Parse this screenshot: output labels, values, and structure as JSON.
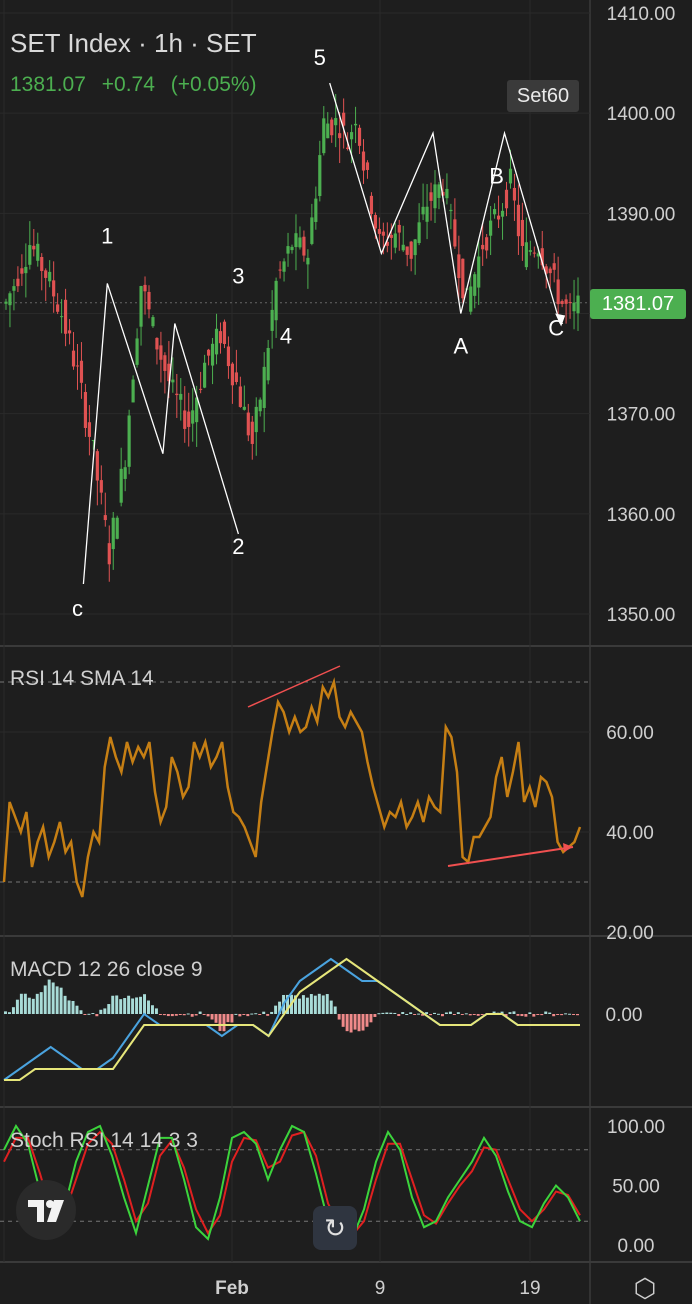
{
  "header": {
    "title": "SET Index · 1h · SET",
    "price": "1381.07",
    "change": "+0.74",
    "change_pct": "(+0.05%)"
  },
  "badges": {
    "set60": "Set60",
    "last_price": "1381.07"
  },
  "colors": {
    "background": "#1e1e1e",
    "up": "#4caf50",
    "down": "#e05252",
    "rsi": "#c67f14",
    "macd": "#4aa3df",
    "signal": "#e6e67a",
    "stoch_k": "#3cd43c",
    "stoch_d": "#e02020",
    "annotation": "#ffffff",
    "divergence": "#f05050"
  },
  "icons": {
    "logo": "tradingview-logo-icon",
    "reset": "reset-rotate-icon",
    "settings": "settings-hexagon-icon"
  },
  "chart_data": [
    {
      "type": "candlestick",
      "title": "SET Index · 1h · SET",
      "ylim": [
        1347,
        1410
      ],
      "y_ticks": [
        "1410.00",
        "1400.00",
        "1390.00",
        "1381.07",
        "1370.00",
        "1360.00",
        "1350.00"
      ],
      "x_ticks": [
        "Feb",
        "9",
        "19"
      ],
      "bars": 145,
      "close_path": [
        [
          0,
          1381
        ],
        [
          6,
          1387
        ],
        [
          10,
          1384
        ],
        [
          14,
          1380
        ],
        [
          18,
          1374
        ],
        [
          22,
          1366
        ],
        [
          26,
          1356
        ],
        [
          30,
          1366
        ],
        [
          34,
          1383
        ],
        [
          38,
          1377
        ],
        [
          42,
          1372
        ],
        [
          46,
          1369
        ],
        [
          50,
          1375
        ],
        [
          54,
          1378
        ],
        [
          58,
          1373
        ],
        [
          62,
          1367
        ],
        [
          65,
          1374
        ],
        [
          68,
          1383
        ],
        [
          72,
          1387
        ],
        [
          76,
          1386
        ],
        [
          80,
          1399
        ],
        [
          84,
          1399
        ],
        [
          86,
          1397
        ],
        [
          88,
          1400
        ],
        [
          90,
          1395
        ],
        [
          94,
          1387
        ],
        [
          98,
          1388
        ],
        [
          102,
          1386
        ],
        [
          106,
          1391
        ],
        [
          110,
          1393
        ],
        [
          112,
          1389
        ],
        [
          116,
          1381
        ],
        [
          120,
          1387
        ],
        [
          124,
          1390
        ],
        [
          127,
          1393
        ],
        [
          130,
          1386
        ],
        [
          134,
          1387
        ],
        [
          138,
          1383
        ],
        [
          140,
          1381
        ],
        [
          142,
          1380
        ],
        [
          145,
          1381
        ]
      ],
      "wave_labels": [
        {
          "label": "1",
          "x": 26,
          "y": 1382
        },
        {
          "label": "2",
          "x": 59,
          "y": 1358
        },
        {
          "label": "3",
          "x": 59,
          "y": 1380
        },
        {
          "label": "4",
          "x": 71,
          "y": 1380
        },
        {
          "label": "5",
          "x": 82,
          "y": 1402
        },
        {
          "label": "c",
          "x": 20,
          "y": 1353
        },
        {
          "label": "A",
          "x": 115,
          "y": 1380
        },
        {
          "label": "B",
          "x": 124,
          "y": 1392
        },
        {
          "label": "C",
          "x": 139,
          "y": 1380
        }
      ],
      "wave_path": [
        [
          20,
          1353
        ],
        [
          26,
          1383
        ],
        [
          40,
          1366
        ],
        [
          43,
          1379
        ],
        [
          59,
          1358
        ]
      ],
      "wave_path2": [
        [
          82,
          1403
        ],
        [
          95,
          1386
        ],
        [
          108,
          1398
        ],
        [
          115,
          1380
        ],
        [
          126,
          1398
        ],
        [
          140,
          1379
        ]
      ]
    },
    {
      "type": "line",
      "title": "RSI 14 SMA 14",
      "ylim": [
        20,
        73
      ],
      "y_ticks": [
        "60.00",
        "40.00",
        "20.00"
      ],
      "levels": [
        70,
        30
      ],
      "values": [
        30,
        46,
        43,
        40,
        44,
        33,
        38,
        41,
        35,
        38,
        42,
        36,
        38,
        30,
        27,
        35,
        40,
        38,
        53,
        59,
        55,
        52,
        58,
        54,
        57,
        55,
        58,
        48,
        42,
        45,
        55,
        52,
        47,
        49,
        58,
        55,
        58,
        53,
        55,
        58,
        49,
        44,
        43,
        41,
        38,
        35,
        46,
        53,
        60,
        66,
        64,
        60,
        63,
        60,
        61,
        65,
        62,
        69,
        67,
        70,
        63,
        61,
        64,
        62,
        60,
        54,
        49,
        45,
        41,
        44,
        43,
        46,
        41,
        43,
        46,
        42,
        47,
        45,
        44,
        61,
        59,
        52,
        35,
        34,
        39,
        39,
        41,
        43,
        51,
        55,
        47,
        52,
        58,
        46,
        49,
        45,
        51,
        50,
        47,
        38,
        36,
        37,
        38,
        41
      ]
    },
    {
      "type": "line",
      "title": "MACD 12 26 close 9",
      "ylim": [
        -7,
        6
      ],
      "y_ticks": [
        "0.00"
      ],
      "series": [
        {
          "values": [
            -6,
            -5,
            -4,
            -3,
            -4,
            -5,
            -5,
            -4,
            -2,
            0,
            -1,
            -1,
            -1,
            -1,
            -2,
            -1,
            -1,
            -2,
            1,
            3,
            4,
            5,
            4,
            3,
            3,
            2,
            1,
            0,
            -1,
            -1,
            -1,
            0,
            0,
            -1,
            -1,
            -1,
            -1,
            -1
          ]
        },
        {
          "values": [
            -6,
            -6,
            -5,
            -5,
            -5,
            -5,
            -5,
            -5,
            -3,
            -1,
            -1,
            -1,
            -1,
            -1,
            -1,
            -1,
            -1,
            -2,
            0,
            2,
            3,
            4,
            5,
            4,
            3,
            2,
            1,
            0,
            -1,
            -1,
            -1,
            0,
            0,
            -1,
            -1,
            -1,
            -1,
            -1
          ]
        }
      ]
    },
    {
      "type": "line",
      "title": "Stoch RSI 14 14 3 3",
      "ylim": [
        -5,
        110
      ],
      "y_ticks": [
        "100.00",
        "50.00",
        "0.00"
      ],
      "levels": [
        80,
        20
      ],
      "series": [
        {
          "values": [
            80,
            100,
            85,
            45,
            15,
            30,
            70,
            95,
            100,
            75,
            40,
            10,
            50,
            90,
            90,
            55,
            15,
            5,
            40,
            90,
            95,
            85,
            55,
            80,
            100,
            95,
            60,
            20,
            10,
            5,
            30,
            70,
            95,
            80,
            40,
            15,
            20,
            40,
            55,
            70,
            90,
            75,
            45,
            20,
            15,
            35,
            50,
            40,
            20
          ]
        },
        {
          "values": [
            70,
            90,
            90,
            60,
            25,
            25,
            55,
            85,
            95,
            85,
            55,
            20,
            35,
            75,
            88,
            65,
            30,
            10,
            25,
            70,
            90,
            88,
            65,
            70,
            92,
            95,
            75,
            35,
            15,
            8,
            20,
            55,
            85,
            85,
            55,
            25,
            18,
            35,
            50,
            62,
            82,
            80,
            55,
            30,
            20,
            30,
            45,
            42,
            25
          ]
        }
      ]
    }
  ]
}
